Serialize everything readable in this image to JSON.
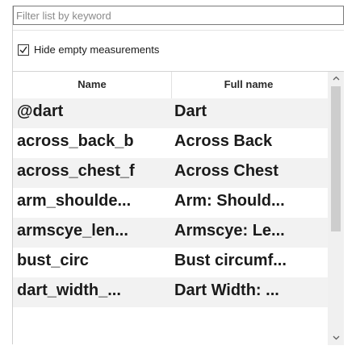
{
  "filter": {
    "placeholder": "Filter list by keyword",
    "value": ""
  },
  "hide_empty": {
    "label": "Hide empty measurements",
    "checked": true
  },
  "table": {
    "columns": [
      "Name",
      "Full name"
    ],
    "rows": [
      [
        "@dart",
        "Dart"
      ],
      [
        "across_back_b",
        "Across Back"
      ],
      [
        "across_chest_f",
        "Across Chest"
      ],
      [
        "arm_shoulde...",
        "Arm: Should..."
      ],
      [
        "armscye_len...",
        "Armscye: Le..."
      ],
      [
        "bust_circ",
        "Bust circumf..."
      ],
      [
        "dart_width_...",
        "Dart Width: ..."
      ]
    ]
  },
  "scrollbar": {
    "up_icon": "chevron-up-icon",
    "down_icon": "chevron-down-icon"
  }
}
